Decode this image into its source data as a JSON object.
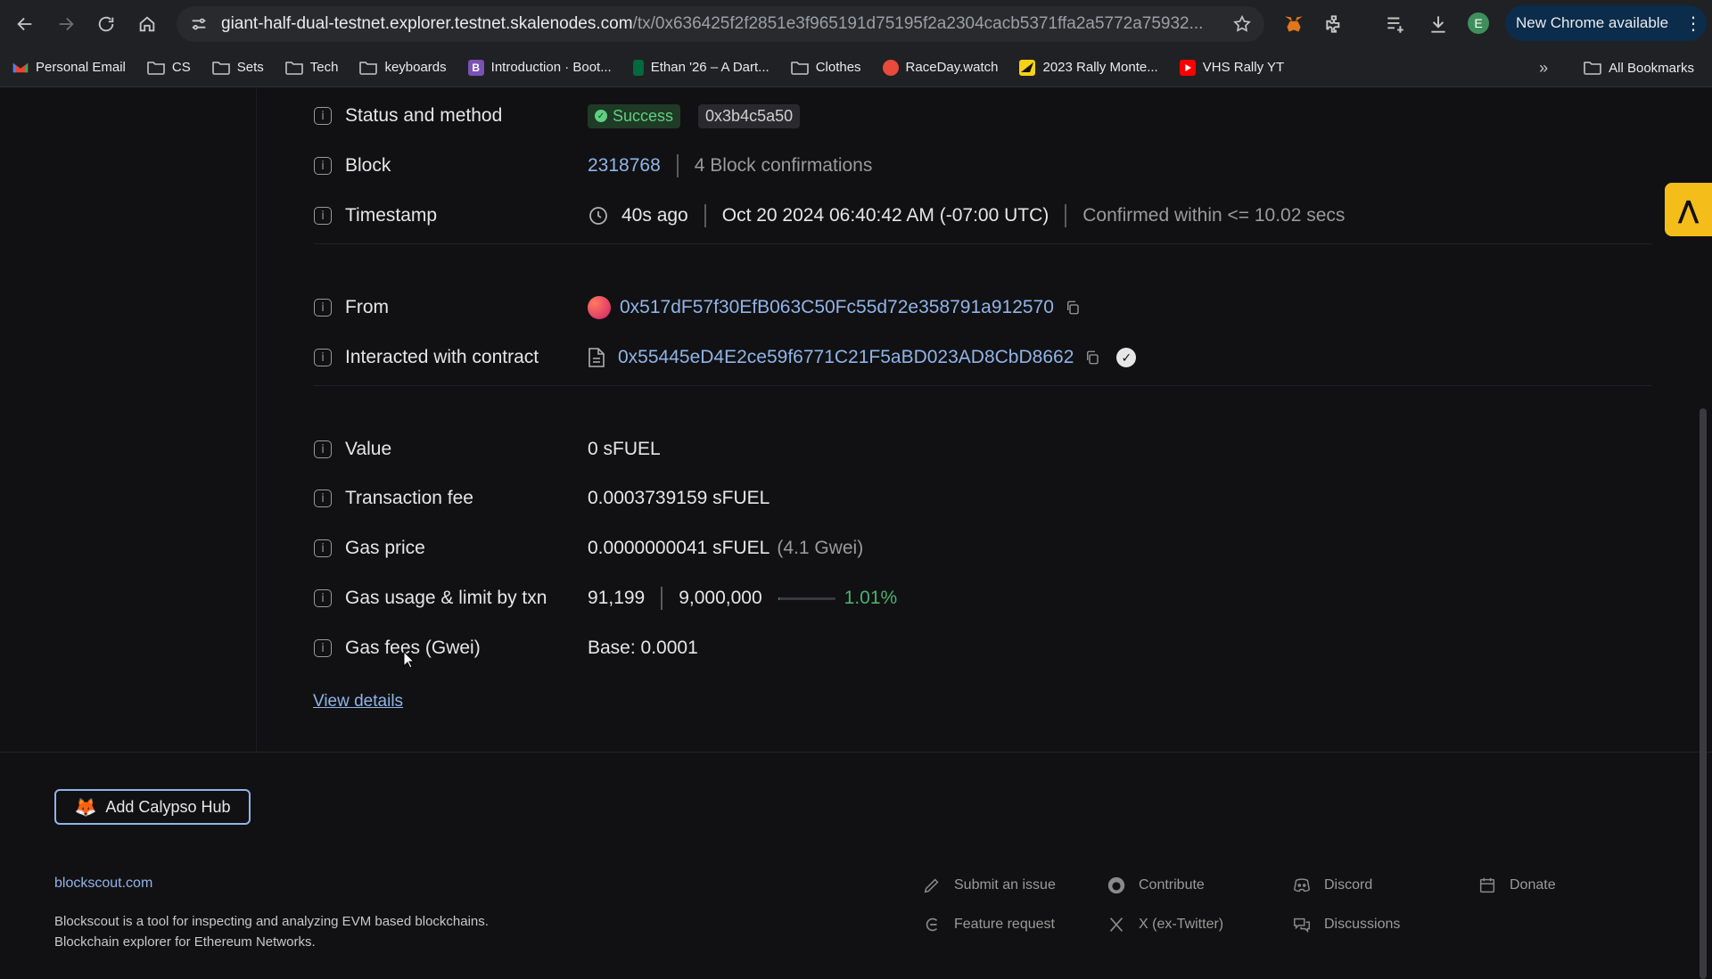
{
  "browser": {
    "url_host": "giant-half-dual-testnet.explorer.testnet.skalenodes.com",
    "url_path": "/tx/0x636425f2f2851e3f965191d75195f2a2304cacb5371ffa2a5772a75932...",
    "profile_initial": "E",
    "update_label": "New Chrome available"
  },
  "bookmarks": {
    "items": [
      {
        "label": "Personal Email",
        "icon": "gmail-icon"
      },
      {
        "label": "CS",
        "icon": "folder-icon"
      },
      {
        "label": "Sets",
        "icon": "folder-icon"
      },
      {
        "label": "Tech",
        "icon": "folder-icon"
      },
      {
        "label": "keyboards",
        "icon": "folder-icon"
      },
      {
        "label": "Introduction · Boot...",
        "icon": "bootstrap-icon"
      },
      {
        "label": "Ethan '26 – A Dart...",
        "icon": "dartmouth-icon"
      },
      {
        "label": "Clothes",
        "icon": "folder-icon"
      },
      {
        "label": "RaceDay.watch",
        "icon": "raceday-icon"
      },
      {
        "label": "2023 Rally Monte...",
        "icon": "rally-icon"
      },
      {
        "label": "VHS Rally YT",
        "icon": "youtube-icon"
      }
    ],
    "all_label": "All Bookmarks"
  },
  "tx": {
    "status": {
      "label": "Status and method",
      "badge": "Success",
      "method": "0x3b4c5a50"
    },
    "block": {
      "label": "Block",
      "number": "2318768",
      "confirmations": "4 Block confirmations"
    },
    "timestamp": {
      "label": "Timestamp",
      "ago": "40s ago",
      "datetime": "Oct 20 2024 06:40:42 AM (-07:00 UTC)",
      "confirmed": "Confirmed within <= 10.02 secs"
    },
    "from": {
      "label": "From",
      "address": "0x517dF57f30EfB063C50Fc55d72e358791a912570"
    },
    "contract": {
      "label": "Interacted with contract",
      "address": "0x55445eD4E2ce59f6771C21F5aBD023AD8CbD8662"
    },
    "value": {
      "label": "Value",
      "amount": "0 sFUEL"
    },
    "fee": {
      "label": "Transaction fee",
      "amount": "0.0003739159 sFUEL"
    },
    "gas_price": {
      "label": "Gas price",
      "amount": "0.0000000041 sFUEL",
      "gwei": "(4.1 Gwei)"
    },
    "gas_usage": {
      "label": "Gas usage & limit by txn",
      "used": "91,199",
      "limit": "9,000,000",
      "percent": "1.01%",
      "fraction": 0.0101
    },
    "gas_fees": {
      "label": "Gas fees (Gwei)",
      "base": "Base: 0.0001"
    },
    "view_details": "View details"
  },
  "footer": {
    "add_hub": "Add Calypso Hub",
    "site": "blockscout.com",
    "desc_line1": "Blockscout is a tool for inspecting and analyzing EVM based blockchains.",
    "desc_line2": "Blockchain explorer for Ethereum Networks.",
    "links": {
      "submit_issue": "Submit an issue",
      "contribute": "Contribute",
      "discord": "Discord",
      "donate": "Donate",
      "feature_request": "Feature request",
      "twitter": "X (ex-Twitter)",
      "discussions": "Discussions"
    }
  }
}
